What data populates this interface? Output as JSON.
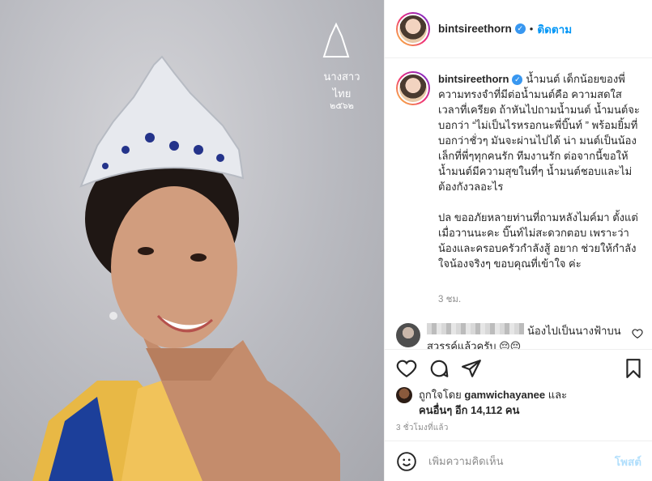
{
  "post": {
    "username": "bintsireethorn",
    "follow_label": "ติดตาม",
    "dot": "•",
    "caption_username": "bintsireethorn",
    "caption_text": "น้ำมนต์ เด็กน้อยของพี่ ความทรงจำที่มีต่อน้ำมนต์คือ ความสดใส เวลาที่เครียด ถ้าหันไปถามน้ำมนต์ น้ำมนต์จะบอกว่า “ไม่เป็นไรหรอกนะพี่บิ๊นท์ ” พร้อมยิ้มที่บอกว่าชั่วๆ มันจะผ่านไปได้ น่า มนต์เป็นน้องเล็กที่พี่ๆทุกคนรัก ทีมงานรัก ต่อจากนี้ขอให้น้ำมนต์มีความสุขในที่ๆ น้ำมนต์ชอบและไม่ต้องกังวลอะไร\n\nปล ขออภัยหลายท่านที่ถามหลังไมค์มา ตั้งแต่เมื่อวานนะคะ บิ๊นท์ไม่สะดวกตอบ เพราะว่าน้องและครอบครัวกำลังสู้ อยาก ช่วยให้กำลังใจน้องจริงๆ ขอบคุณที่เข้าใจ ค่ะ",
    "caption_time": "3 ชม.",
    "comment_text": "น้องไปเป็นนางฟ้าบนสวรรค์แล้วครับ 😔😔",
    "liked_by_prefix": "ถูกใจโดย",
    "liked_by_user": "gamwichayanee",
    "liked_by_and": "และ",
    "liked_by_others": "คนอื่นๆ อีก 14,112 คน",
    "time_ago": "3 ชั่วโมงที่แล้ว",
    "comment_placeholder": "เพิ่มความคิดเห็น",
    "post_button": "โพสต์"
  },
  "photo": {
    "watermark_line1": "นางสาวไทย",
    "watermark_line2": "๒๕๖๒"
  },
  "icons": {
    "verified": "verified-badge",
    "like": "heart-icon",
    "comment": "comment-icon",
    "share": "paper-plane-icon",
    "save": "bookmark-icon",
    "emoji": "smile-icon"
  },
  "colors": {
    "accent": "#0095f6",
    "verified": "#3897f0",
    "muted": "#8e8e8e",
    "post_disabled": "#b2dffc"
  }
}
